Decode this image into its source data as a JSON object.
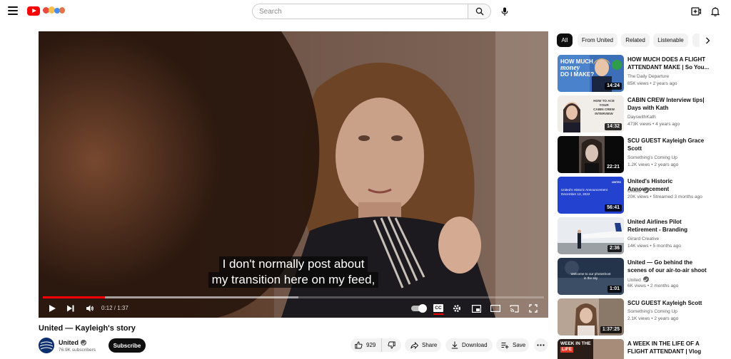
{
  "masthead": {
    "search_placeholder": "Search"
  },
  "player": {
    "caption_line1": "I don't normally post about",
    "caption_line2": "my transition here on my feed,",
    "time_display": "0:12 / 1:37",
    "progress_played_pct": 12.4,
    "progress_loaded_pct": 51,
    "cc_label": "CC"
  },
  "video": {
    "title": "United — Kayleigh's story",
    "channel_name": "United",
    "subscriber_count": "76.9K subscribers",
    "subscribe_label": "Subscribe",
    "like_count": "929",
    "share_label": "Share",
    "download_label": "Download",
    "save_label": "Save"
  },
  "sidebar": {
    "chips": [
      "All",
      "From United",
      "Related",
      "Listenable"
    ],
    "recommendations": [
      {
        "title": "HOW MUCH DOES A FLIGHT ATTENDANT MAKE | So You...",
        "channel": "The Daily Departure",
        "meta": "85K views • 2 years ago",
        "duration": "14:24",
        "verified": false
      },
      {
        "title": "CABIN CREW Interview tips| Days with Kath",
        "channel": "DayswithKath",
        "meta": "473K views • 4 years ago",
        "duration": "14:32",
        "verified": false
      },
      {
        "title": "SCU GUEST Kayleigh Grace Scott",
        "channel": "Something's Coming Up",
        "meta": "1.2K views • 2 years ago",
        "duration": "22:21",
        "verified": false
      },
      {
        "title": "United's Historic Announcement",
        "channel": "United",
        "meta": "20K views • Streamed 3 months ago",
        "duration": "56:41",
        "verified": true
      },
      {
        "title": "United Airlines Pilot Retirement - Branding Session BTS",
        "channel": "Girard Creative",
        "meta": "14K views • 5 months ago",
        "duration": "2:36",
        "verified": false
      },
      {
        "title": "United — Go behind the scenes of our air-to-air shoot",
        "channel": "United",
        "meta": "6K views • 2 months ago",
        "duration": "1:01",
        "verified": true
      },
      {
        "title": "SCU GUEST Kayleigh Scott",
        "channel": "Something's Coming Up",
        "meta": "2.1K views • 2 years ago",
        "duration": "1:37:25",
        "verified": false
      },
      {
        "title": "A WEEK IN THE LIFE OF A FLIGHT ATTENDANT | Vlog",
        "channel": "",
        "meta": "",
        "duration": "",
        "verified": false
      }
    ],
    "thumb_text": {
      "rec0_line1": "HOW MUCH",
      "rec0_line2": "money",
      "rec0_line3": "DO I MAKE?",
      "rec1_line1": "HOW TO ACE",
      "rec1_line2": "YOUR",
      "rec1_line3": "CABIN CREW",
      "rec1_line4": "INTERVIEW",
      "rec3_brand": "UNITED",
      "rec3_line1": "United's Historic Announcement",
      "rec3_line2": "December 13, 2022",
      "rec5_line1": "Welcome to our photoshoot",
      "rec5_line2": "in the sky",
      "rec7_line1": "WEEK IN THE",
      "rec7_line2": "LIFE"
    }
  }
}
